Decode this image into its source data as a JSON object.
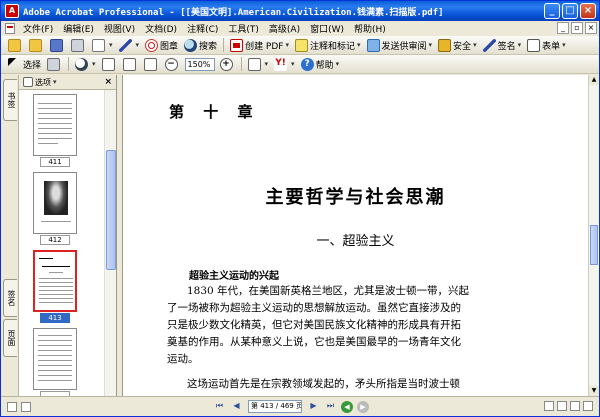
{
  "window": {
    "title": "Adobe Acrobat Professional - [[美国文明].American.Civilization.钱满素.扫描版.pdf]"
  },
  "menu": {
    "items": [
      "文件(F)",
      "编辑(E)",
      "视图(V)",
      "文档(D)",
      "注释(C)",
      "工具(T)",
      "高级(A)",
      "窗口(W)",
      "帮助(H)"
    ]
  },
  "toolbar1": {
    "web_label": "图章",
    "search_label": "搜索",
    "create_pdf_label": "创建 PDF",
    "comment_label": "注释和标记",
    "send_label": "发送供审阅",
    "security_label": "安全",
    "sign_label": "签名",
    "forms_label": "表单"
  },
  "toolbar2": {
    "select_label": "选择",
    "zoom_value": "150%",
    "help_label": "帮助"
  },
  "nav_panel": {
    "tab_bookmarks": "书签",
    "tab_signatures": "签名",
    "tab_pages": "页面",
    "options_label": "选项",
    "thumbnails": [
      {
        "label": "411"
      },
      {
        "label": "412"
      },
      {
        "label": "413"
      },
      {
        "label": ""
      }
    ]
  },
  "document": {
    "chapter": "第 十 章",
    "title": "主要哲学与社会思潮",
    "section": "一、超验主义",
    "subheading": "超验主义运动的兴起",
    "para1": [
      "1830 年代，在美国新英格兰地区，尤其是波士顿一带，兴起",
      "了一场被称为超验主义运动的思想解放运动。虽然它直接涉及的",
      "只是极少数文化精英，但它对美国民族文化精神的形成具有开拓",
      "奠基的作用。从某种意义上说，它也是美国最早的一场青年文化",
      "运动。"
    ],
    "para2": [
      "这场运动首先是在宗教领域发起的，矛头所指是当时波士顿"
    ]
  },
  "statusbar": {
    "page_indicator": "第 413 / 469 页"
  }
}
